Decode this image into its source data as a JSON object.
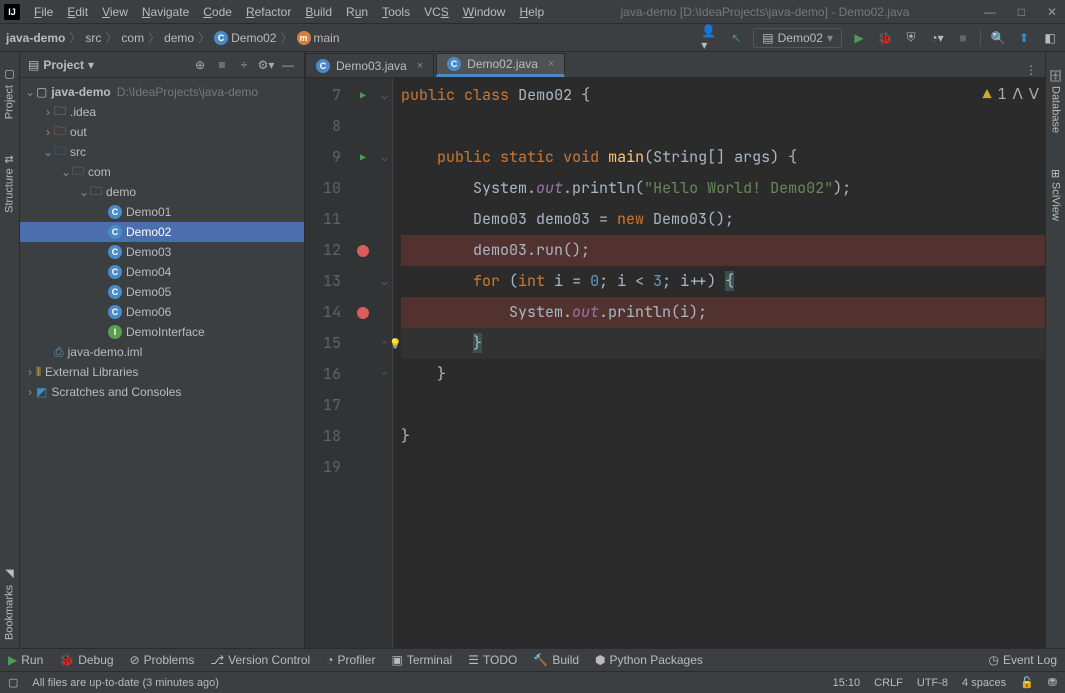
{
  "title": "java-demo [D:\\IdeaProjects\\java-demo] - Demo02.java",
  "menus": [
    "File",
    "Edit",
    "View",
    "Navigate",
    "Code",
    "Refactor",
    "Build",
    "Run",
    "Tools",
    "VCS",
    "Window",
    "Help"
  ],
  "breadcrumb": {
    "root": "java-demo",
    "items": [
      "src",
      "com",
      "demo"
    ],
    "class": "Demo02",
    "method": "main"
  },
  "run_config": "Demo02",
  "left_tabs": [
    "Project",
    "Structure",
    "Bookmarks"
  ],
  "right_tabs": [
    "Database",
    "SciView"
  ],
  "panel_title": "Project",
  "tree": {
    "root": "java-demo",
    "root_path": "D:\\IdeaProjects\\java-demo",
    "idea": ".idea",
    "out": "out",
    "src": "src",
    "com": "com",
    "demo": "demo",
    "files": [
      "Demo01",
      "Demo02",
      "Demo03",
      "Demo04",
      "Demo05",
      "Demo06",
      "DemoInterface"
    ],
    "iml": "java-demo.iml",
    "ext_lib": "External Libraries",
    "scratches": "Scratches and Consoles"
  },
  "tabs": [
    {
      "label": "Demo03.java",
      "active": false
    },
    {
      "label": "Demo02.java",
      "active": true
    }
  ],
  "warnings": "1",
  "line_numbers": [
    "7",
    "8",
    "9",
    "10",
    "11",
    "12",
    "13",
    "14",
    "15",
    "16",
    "17",
    "18",
    "19"
  ],
  "bottom": {
    "run": "Run",
    "debug": "Debug",
    "problems": "Problems",
    "vcs": "Version Control",
    "profiler": "Profiler",
    "terminal": "Terminal",
    "todo": "TODO",
    "build": "Build",
    "python": "Python Packages",
    "eventlog": "Event Log"
  },
  "status": {
    "msg": "All files are up-to-date (3 minutes ago)",
    "pos": "15:10",
    "eol": "CRLF",
    "enc": "UTF-8",
    "indent": "4 spaces"
  },
  "code": {
    "l7_a": "public",
    "l7_b": "class",
    "l7_c": "Demo02 {",
    "l9_a": "public",
    "l9_b": "static",
    "l9_c": "void",
    "l9_d": "main",
    "l9_e": "(String[] args) {",
    "l10_a": "System.",
    "l10_b": "out",
    "l10_c": ".println(",
    "l10_d": "\"Hello World! Demo02\"",
    "l10_e": ");",
    "l11_a": "Demo03 demo03 = ",
    "l11_b": "new",
    "l11_c": " Demo03();",
    "l12": "demo03.run();",
    "l13_a": "for",
    "l13_b": " (",
    "l13_c": "int",
    "l13_d": " i = ",
    "l13_e": "0",
    "l13_f": "; i < ",
    "l13_g": "3",
    "l13_h": "; i++) ",
    "l13_i": "{",
    "l14_a": "System.",
    "l14_b": "out",
    "l14_c": ".println(i);",
    "l15": "}",
    "l16": "}",
    "l18": "}"
  }
}
